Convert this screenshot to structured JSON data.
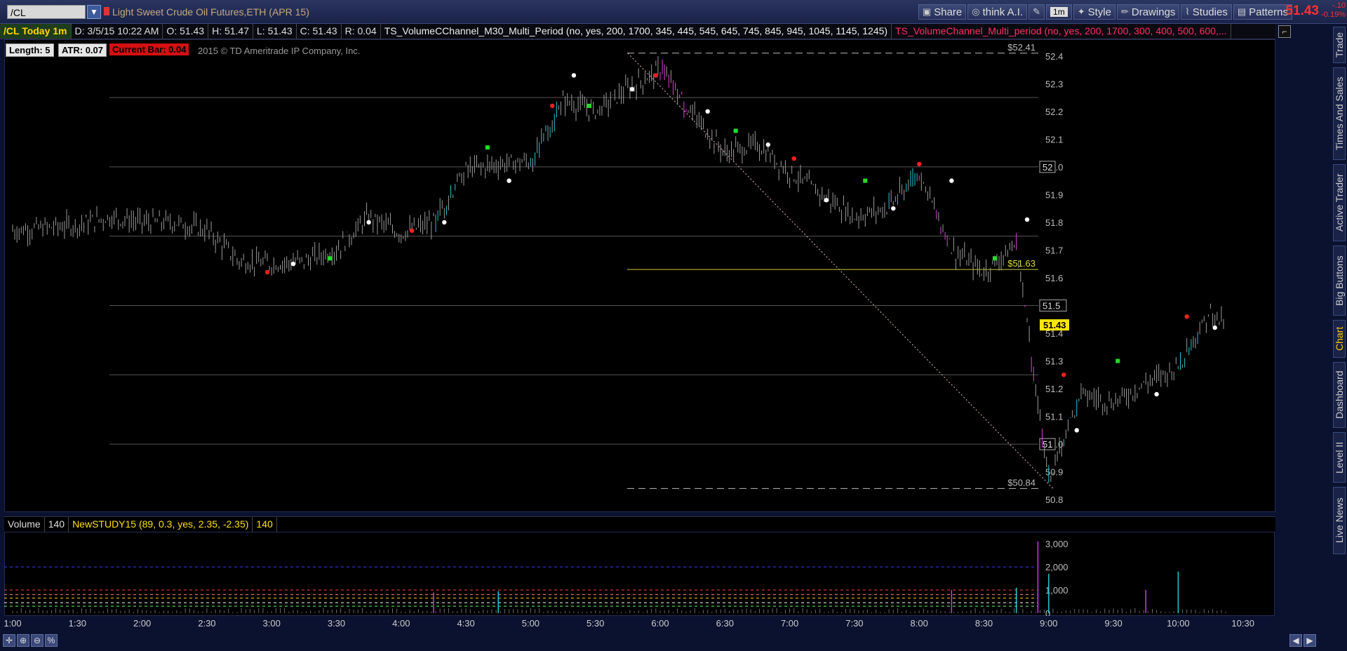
{
  "topbar": {
    "symbol": "/CL",
    "title": "Light Sweet Crude Oil Futures,ETH (APR 15)",
    "buttons": [
      "Share",
      "think A.I.",
      "1m",
      "Style",
      "Drawings",
      "Studies",
      "Patterns"
    ],
    "last_price": "51.43",
    "change_line1": "-.10",
    "change_line2": "-0.19%"
  },
  "infobar": {
    "tick": "/CL Today 1m",
    "date": "D: 3/5/15 10:22 AM",
    "open": "O: 51.43",
    "high": "H: 51.47",
    "low": "L: 51.43",
    "close": "C: 51.43",
    "range": "R: 0.04",
    "study1": "TS_VolumeCChannel_M30_Multi_Period (no, yes, 200, 1700, 345, 445, 545, 645, 745, 845, 945, 1045, 1145, 1245)",
    "study2": "TS_VolumeChannel_Multi_period (no, yes, 200, 1700, 300, 400, 500, 600,..."
  },
  "chart_stats": {
    "length": "Length: 5",
    "atr": "ATR: 0.07",
    "current_bar": "Current Bar: 0.04",
    "copyright": "2015 © TD Ameritrade IP Company, Inc."
  },
  "volume_header": {
    "volume": "Volume",
    "volume_value": "140",
    "study": "NewSTUDY15 (89, 0.3, yes, 2.35, -2.35)",
    "study_value": "140"
  },
  "side_tabs": [
    "Trade",
    "Times And Sales",
    "Active Trader",
    "Big Buttons",
    "Chart",
    "Dashboard",
    "Level II",
    "Live News"
  ],
  "active_tab": "Chart",
  "chart_data": {
    "type": "candlestick",
    "price_axis": {
      "ticks": [
        52.4,
        52.3,
        52.2,
        52.1,
        52,
        51.9,
        51.8,
        51.7,
        51.6,
        51.5,
        51.4,
        51.3,
        51.2,
        51.1,
        51,
        50.9,
        50.8
      ],
      "boxed_labels": [
        "52",
        "51.5",
        "51"
      ],
      "range": [
        50.77,
        52.45
      ]
    },
    "time_axis": [
      "1:00",
      "1:30",
      "2:00",
      "2:30",
      "3:00",
      "3:30",
      "4:00",
      "4:30",
      "5:00",
      "5:30",
      "6:00",
      "6:30",
      "7:00",
      "7:30",
      "8:00",
      "8:30",
      "9:00",
      "9:30",
      "10:00",
      "10:30"
    ],
    "levels": [
      {
        "label": "$52.41",
        "value": 52.41,
        "style": "dashed",
        "color": "#bbbbbb"
      },
      {
        "label": "$51.63",
        "value": 51.63,
        "style": "solid",
        "color": "#cccc33"
      },
      {
        "label": "$50.84",
        "value": 50.84,
        "style": "dashed",
        "color": "#bbbbbb"
      }
    ],
    "channel_lines": [
      52.25,
      52.0,
      51.75,
      51.5,
      51.25,
      51.0
    ],
    "current_price_label": "51.43",
    "close_path": [
      [
        "1:00",
        51.77
      ],
      [
        "1:15",
        51.78
      ],
      [
        "1:30",
        51.79
      ],
      [
        "1:45",
        51.82
      ],
      [
        "2:00",
        51.8
      ],
      [
        "2:15",
        51.8
      ],
      [
        "2:30",
        51.77
      ],
      [
        "2:45",
        51.66
      ],
      [
        "3:00",
        51.65
      ],
      [
        "3:15",
        51.66
      ],
      [
        "3:30",
        51.7
      ],
      [
        "3:45",
        51.82
      ],
      [
        "4:00",
        51.76
      ],
      [
        "4:15",
        51.8
      ],
      [
        "4:30",
        51.99
      ],
      [
        "4:45",
        52.01
      ],
      [
        "5:00",
        52.02
      ],
      [
        "5:15",
        52.24
      ],
      [
        "5:30",
        52.2
      ],
      [
        "5:45",
        52.28
      ],
      [
        "6:00",
        52.35
      ],
      [
        "6:15",
        52.19
      ],
      [
        "6:30",
        52.05
      ],
      [
        "6:45",
        52.08
      ],
      [
        "7:00",
        51.98
      ],
      [
        "7:15",
        51.9
      ],
      [
        "7:30",
        51.82
      ],
      [
        "7:45",
        51.85
      ],
      [
        "8:00",
        51.98
      ],
      [
        "8:15",
        51.7
      ],
      [
        "8:30",
        51.62
      ],
      [
        "8:45",
        51.72
      ],
      [
        "9:00",
        50.87
      ],
      [
        "9:15",
        51.18
      ],
      [
        "9:30",
        51.15
      ],
      [
        "9:45",
        51.22
      ],
      [
        "10:00",
        51.28
      ],
      [
        "10:15",
        51.48
      ],
      [
        "10:22",
        51.43
      ]
    ],
    "volume_axis": {
      "ticks": [
        "3,000",
        "2,000",
        "1,000",
        "0"
      ],
      "range": [
        0,
        3400
      ]
    },
    "volume_spikes": [
      [
        "4:15",
        900
      ],
      [
        "4:45",
        950
      ],
      [
        "8:15",
        1000
      ],
      [
        "8:45",
        1100
      ],
      [
        "8:55",
        3100
      ],
      [
        "9:00",
        1700
      ],
      [
        "9:45",
        1000
      ],
      [
        "10:00",
        1800
      ]
    ]
  }
}
